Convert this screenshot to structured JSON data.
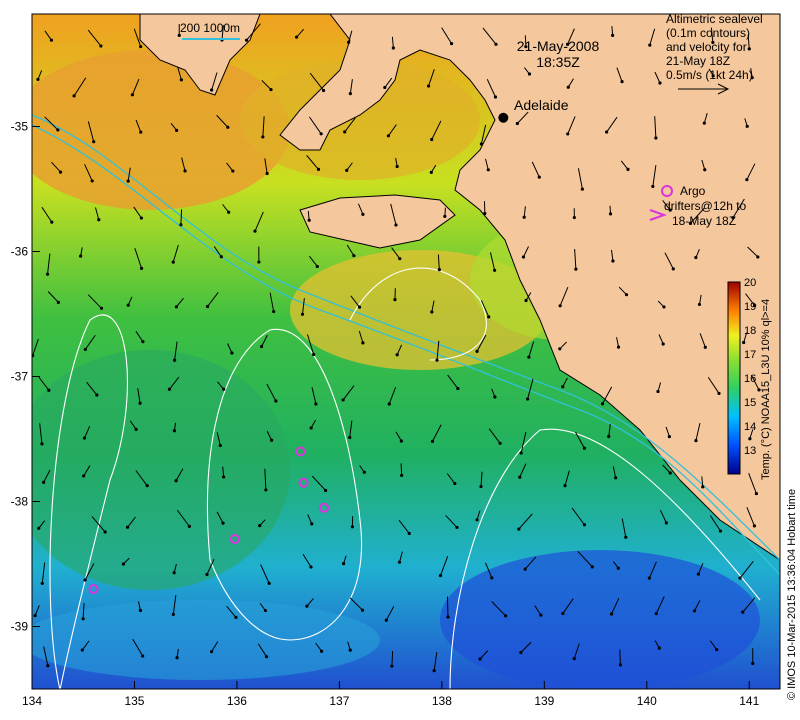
{
  "datetime": {
    "date": "21-May-2008",
    "time": "18:35Z"
  },
  "scale_bar": {
    "label": "200  1000m"
  },
  "legend": {
    "lines": [
      "Altimetric sealevel",
      "(0.1m contours)",
      "and velocity for",
      "21-May 18Z",
      "0.5m/s (1kt 24h)"
    ],
    "arrow_icon": "right-arrow-icon"
  },
  "argo": {
    "label_line1": "Argo",
    "label_line2": "drifters@12h to",
    "label_line3": "18-May 18Z",
    "marker_color": "#dd33dd",
    "floats": [
      {
        "lon": 136.62,
        "lat": -37.6
      },
      {
        "lon": 136.65,
        "lat": -37.85
      },
      {
        "lon": 136.85,
        "lat": -38.05
      },
      {
        "lon": 135.98,
        "lat": -38.3
      },
      {
        "lon": 134.6,
        "lat": -38.7
      }
    ]
  },
  "cities": [
    {
      "name": "Adelaide",
      "lon": 138.6,
      "lat": -34.93
    }
  ],
  "axes": {
    "lon_ticks": [
      "134",
      "135",
      "136",
      "137",
      "138",
      "139",
      "140",
      "141"
    ],
    "lat_ticks": [
      "-35",
      "-36",
      "-37",
      "-38",
      "-39"
    ],
    "lon_range": [
      134,
      141.3
    ],
    "lat_range": [
      -39.5,
      -34.1
    ]
  },
  "colorbar": {
    "label": "Temp. (°C) NOAA15_L3U 10% ql>=4",
    "range": [
      12,
      20
    ],
    "ticks": [
      "20",
      "19",
      "18",
      "17",
      "16",
      "15",
      "14",
      "13"
    ]
  },
  "credit": "© IMOS 10-Mar-2015 13:36:04 Hobart time",
  "colors": {
    "land": "#f5c79c",
    "coastline": "#000000",
    "contour": "#ffffff",
    "isobath": "#33c0d8"
  }
}
